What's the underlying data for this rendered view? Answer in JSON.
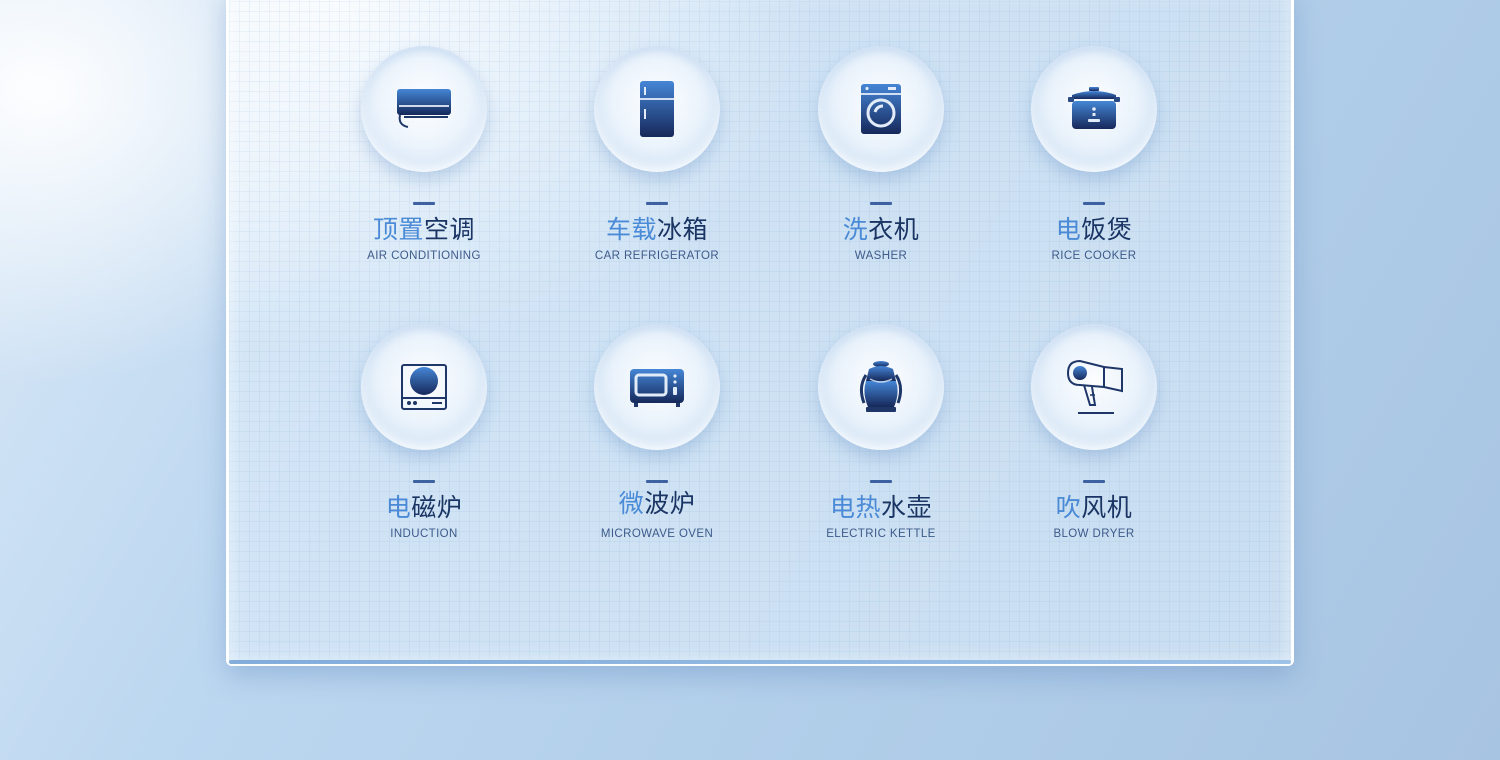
{
  "colors": {
    "accent_light": "#4a8ad6",
    "accent_dark": "#1a3564",
    "icon_top": "#3f7fd0",
    "icon_bottom": "#16285a"
  },
  "appliances": [
    {
      "name_a": "顶置",
      "name_b": "空调",
      "en": "AIR CONDITIONING",
      "icon": "air-conditioner-icon"
    },
    {
      "name_a": "车载",
      "name_b": "冰箱",
      "en": "CAR REFRIGERATOR",
      "icon": "refrigerator-icon"
    },
    {
      "name_a": "洗",
      "name_b": "衣机",
      "en": "WASHER",
      "icon": "washing-machine-icon"
    },
    {
      "name_a": "电",
      "name_b": "饭煲",
      "en": "RICE COOKER",
      "icon": "rice-cooker-icon"
    },
    {
      "name_a": "电",
      "name_b": "磁炉",
      "en": "INDUCTION",
      "icon": "induction-cooker-icon"
    },
    {
      "name_a": "微",
      "name_b": "波炉",
      "en": "MICROWAVE OVEN",
      "icon": "microwave-icon"
    },
    {
      "name_a": "电热",
      "name_b": "水壶",
      "en": "ELECTRIC KETTLE",
      "icon": "kettle-icon"
    },
    {
      "name_a": "吹",
      "name_b": "风机",
      "en": "BLOW DRYER",
      "icon": "hair-dryer-icon"
    }
  ]
}
